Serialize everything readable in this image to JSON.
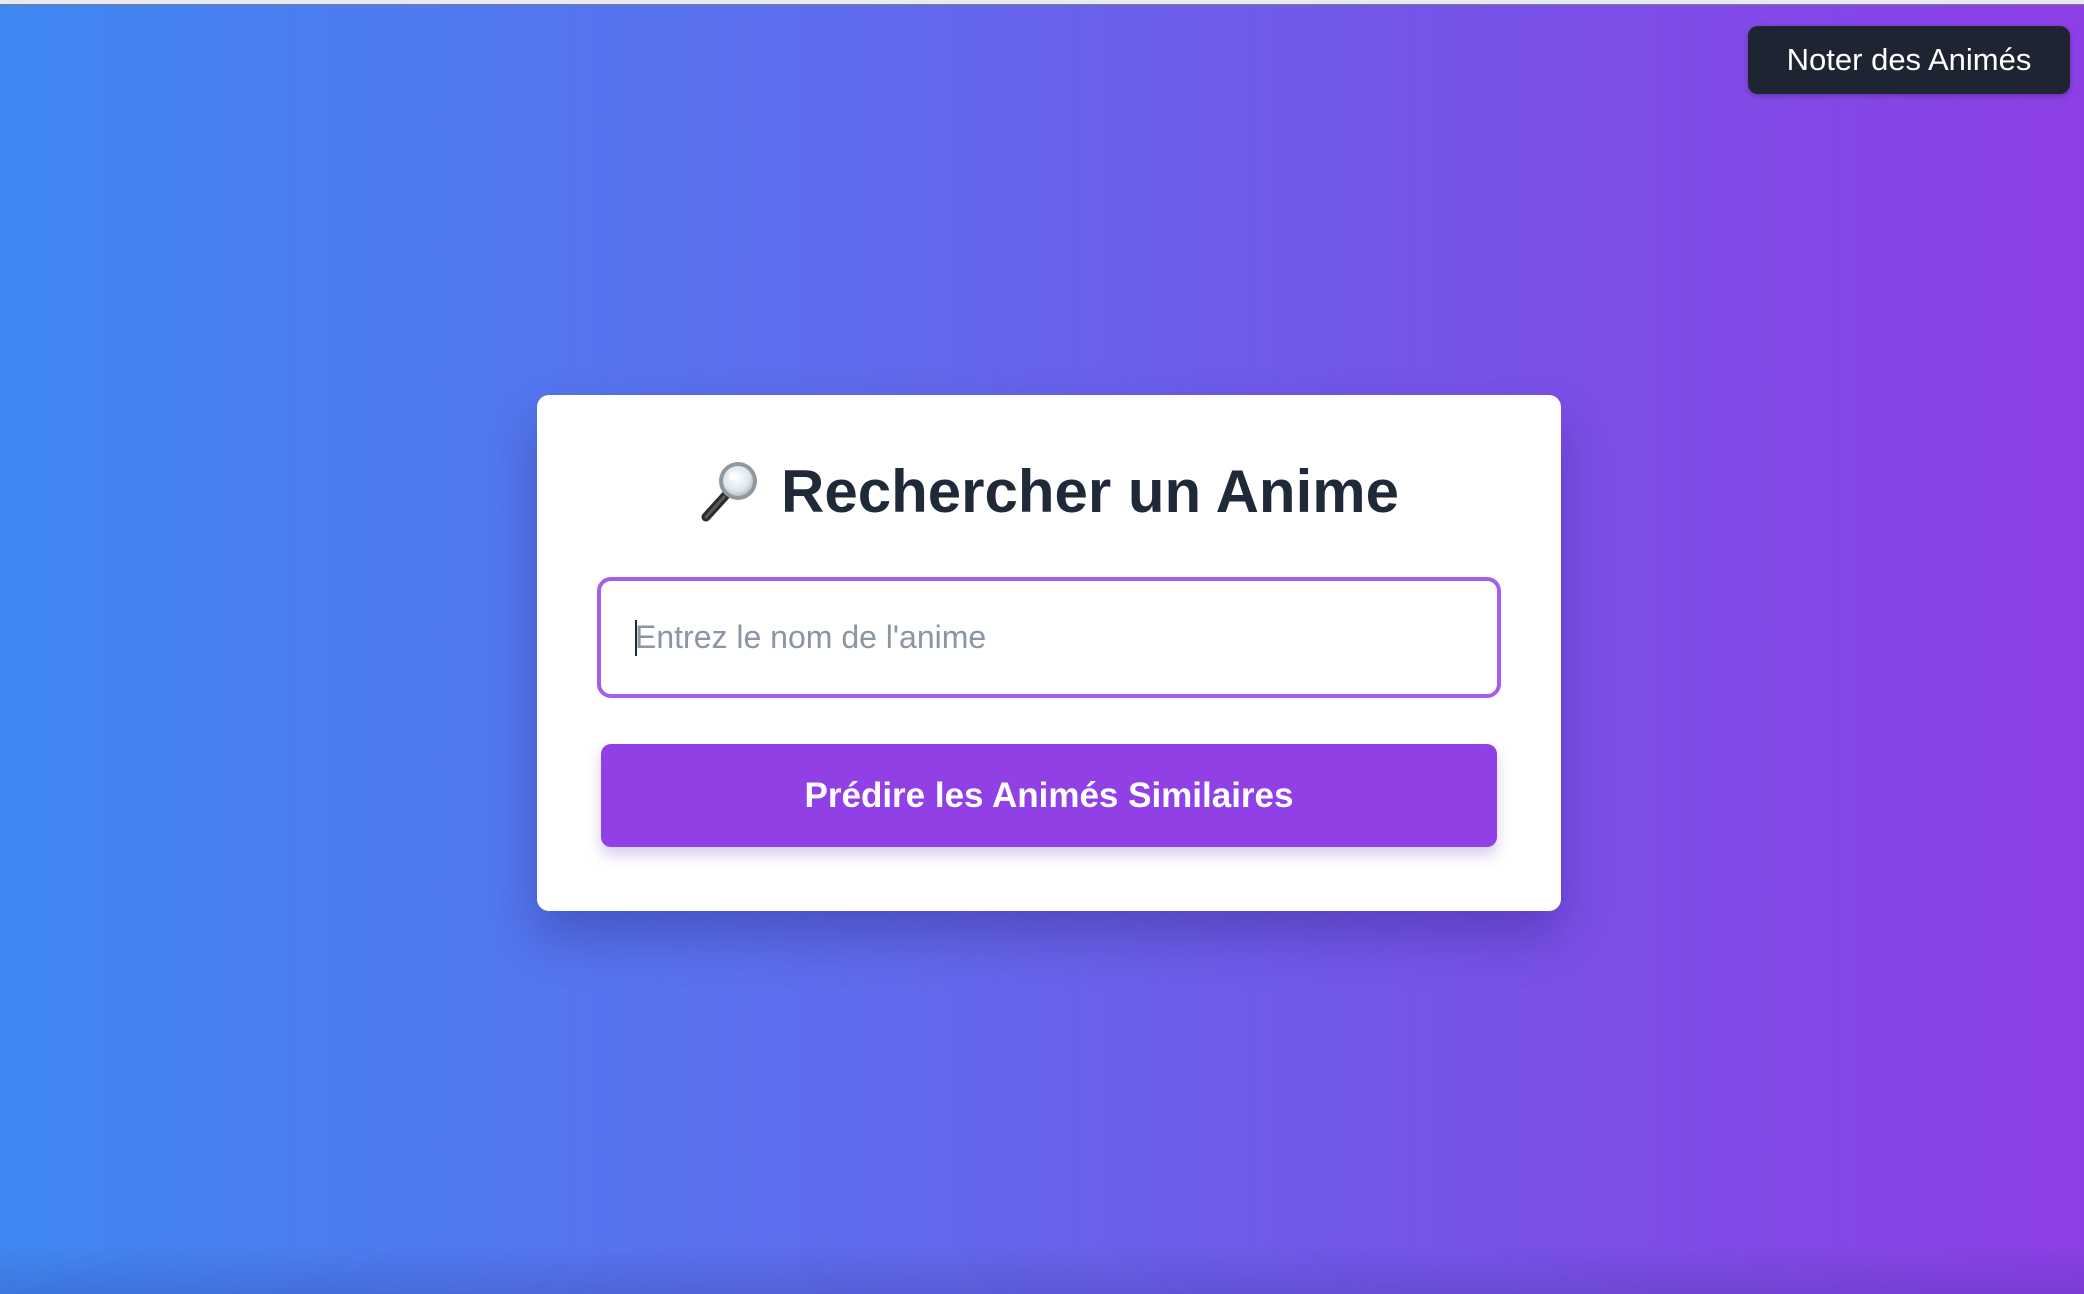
{
  "nav": {
    "rate_button_label": "Noter des Animés"
  },
  "search": {
    "title": "Rechercher un Anime",
    "title_icon": "magnifying-glass-icon",
    "input_value": "",
    "input_placeholder": "Entrez le nom de l'anime",
    "submit_label": "Prédire les Animés Similaires"
  },
  "colors": {
    "gradient_start": "#3f88f2",
    "gradient_end": "#8d3fe6",
    "accent": "#9140e6",
    "input_border": "#a55ee8",
    "nav_button_bg": "#1e2432",
    "title_text": "#1f2937"
  }
}
